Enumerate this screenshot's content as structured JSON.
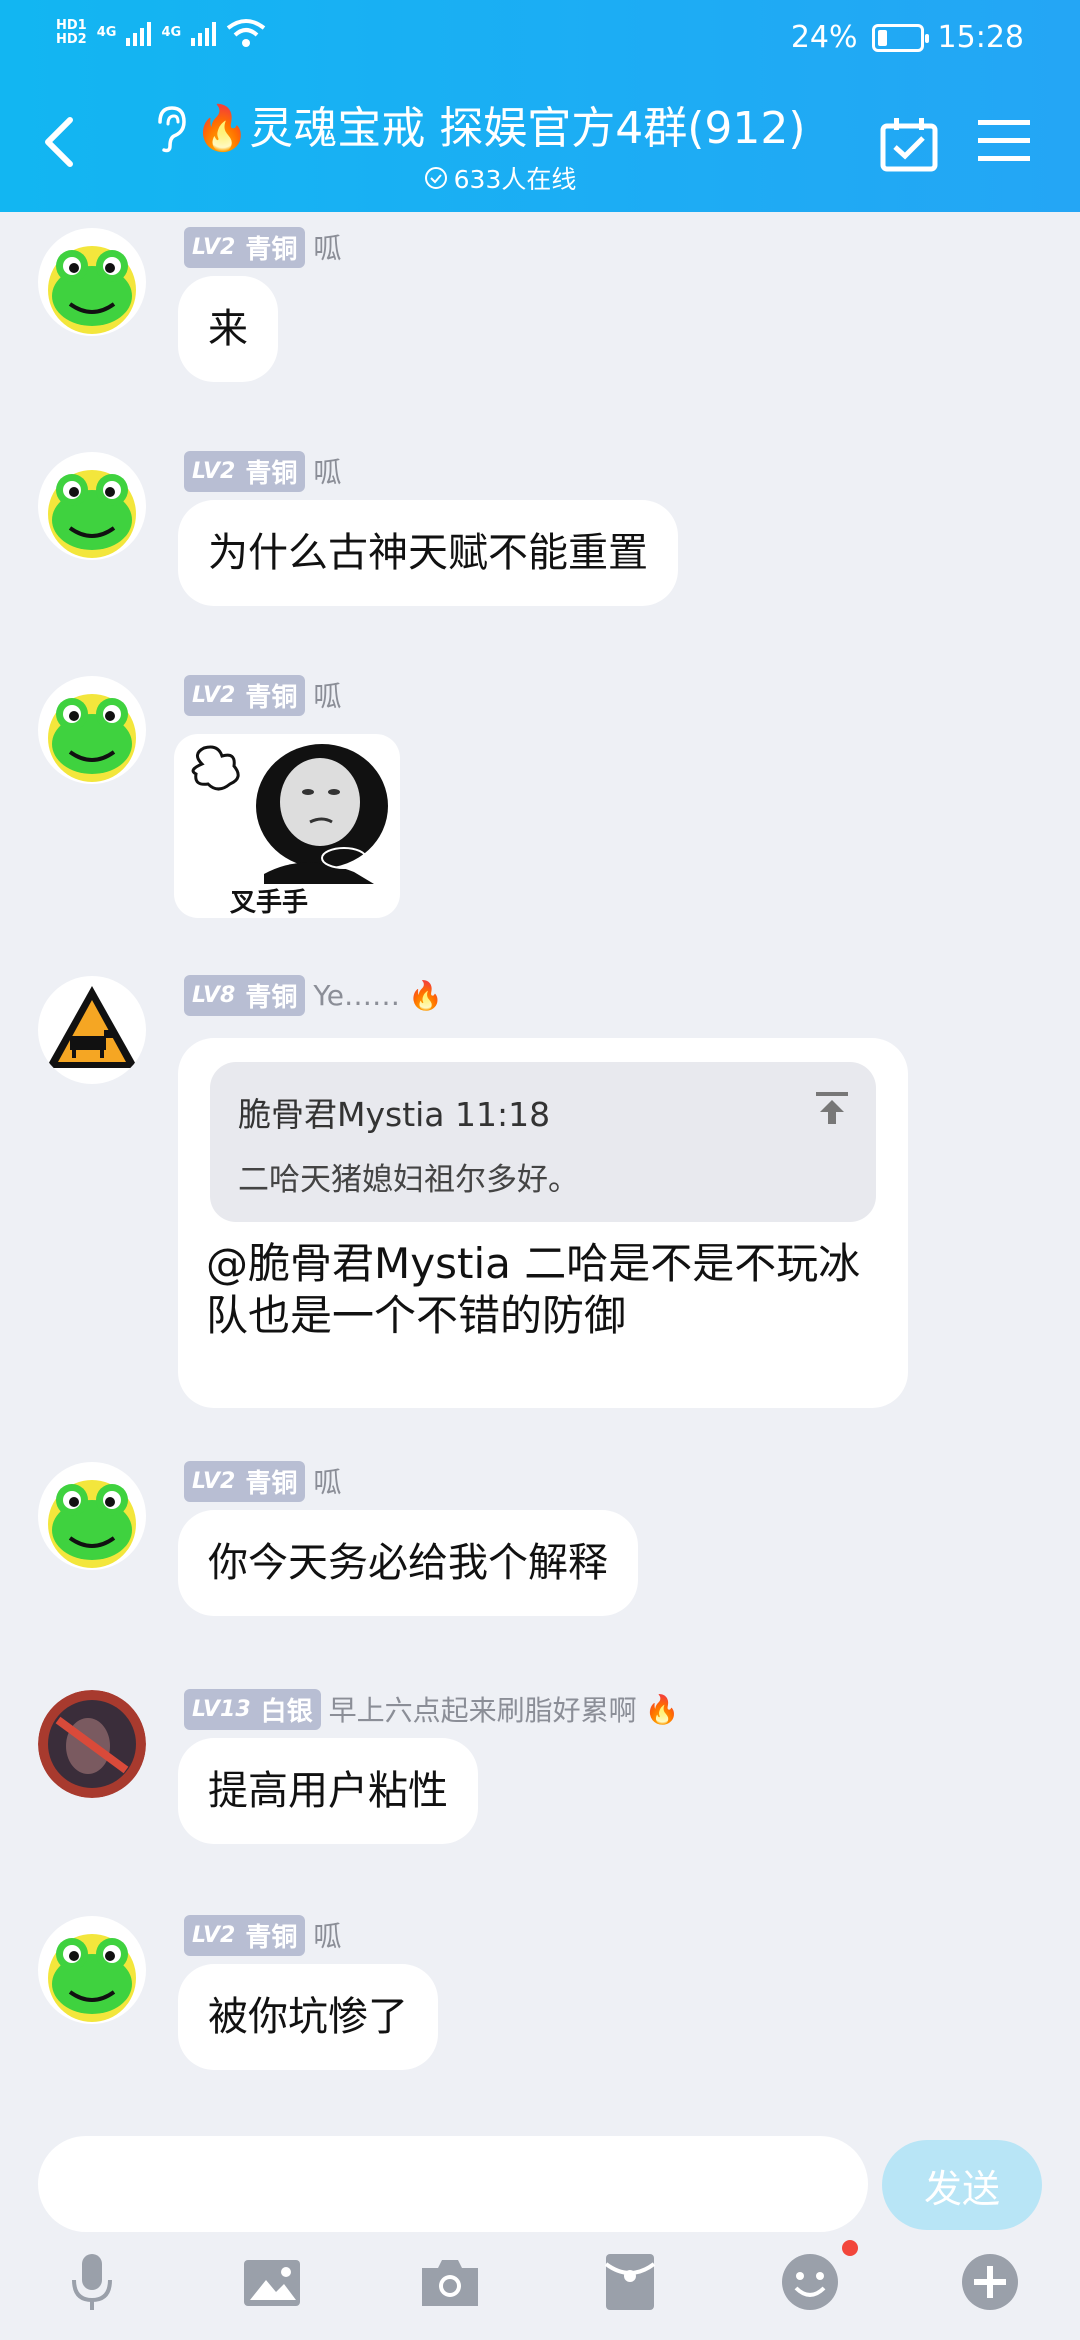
{
  "status_bar": {
    "hd1": "HD1",
    "hd2": "HD2",
    "net1": "4G",
    "net2": "4G",
    "battery": "24%",
    "battery_level": 0.24,
    "time": "15:28"
  },
  "header": {
    "title": "🔥灵魂宝戒 探娱官方4群(912)",
    "online": "633人在线",
    "accent": "#12b6f2"
  },
  "messages": [
    {
      "level": "LV2",
      "rank": "青铜",
      "nick": "呱",
      "text": "来"
    },
    {
      "level": "LV2",
      "rank": "青铜",
      "nick": "呱",
      "text": "为什么古神天赋不能重置"
    },
    {
      "level": "LV2",
      "rank": "青铜",
      "nick": "呱",
      "sticker_caption": "叉手手"
    },
    {
      "level": "LV8",
      "rank": "青铜",
      "nick": "Ye……",
      "reply": {
        "who": "脆骨君Mystia 11:18",
        "quote": "二哈天猪媳妇祖尔多好。"
      },
      "text": "@脆骨君Mystia 二哈是不是不玩冰队也是一个不错的防御"
    },
    {
      "level": "LV2",
      "rank": "青铜",
      "nick": "呱",
      "text": "你今天务必给我个解释"
    },
    {
      "level": "LV13",
      "rank": "白银",
      "nick": "早上六点起来刷脂好累啊",
      "text": "提高用户粘性"
    },
    {
      "level": "LV2",
      "rank": "青铜",
      "nick": "呱",
      "text": "被你坑惨了"
    }
  ],
  "composer": {
    "send_label": "发送"
  }
}
